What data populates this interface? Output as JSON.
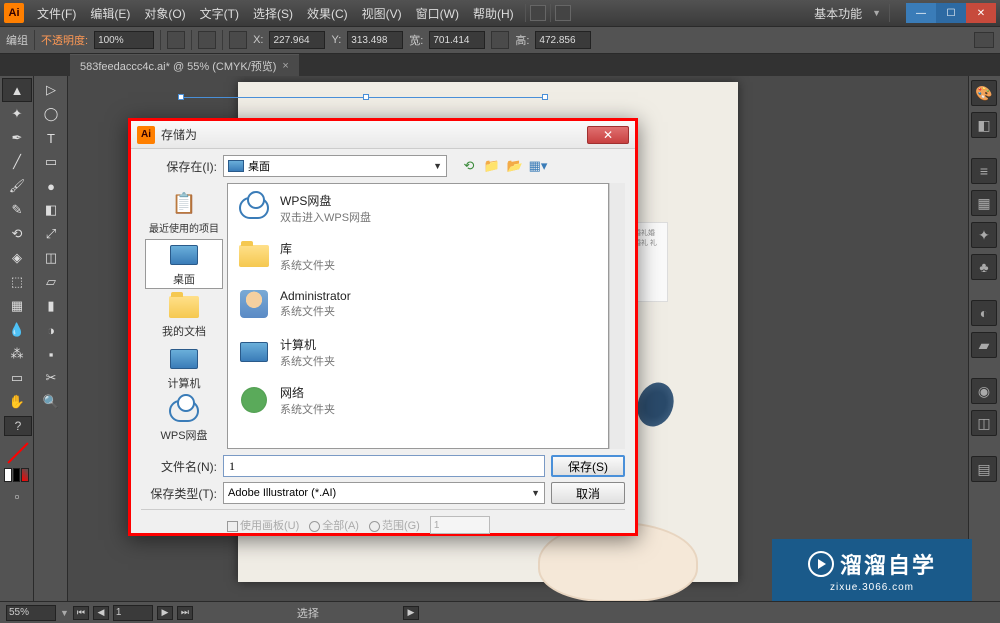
{
  "app": {
    "logo": "Ai"
  },
  "menu": {
    "file": "文件(F)",
    "edit": "编辑(E)",
    "object": "对象(O)",
    "type": "文字(T)",
    "select": "选择(S)",
    "effect": "效果(C)",
    "view": "视图(V)",
    "window": "窗口(W)",
    "help": "帮助(H)"
  },
  "workspace": {
    "label": "基本功能"
  },
  "options": {
    "group": "编组",
    "opacity_label": "不透明度:",
    "opacity_value": "100%",
    "x_label": "X:",
    "x_value": "227.964",
    "y_label": "Y:",
    "y_value": "313.498",
    "w_label": "宽:",
    "w_value": "701.414",
    "h_label": "高:",
    "h_value": "472.856"
  },
  "document": {
    "tab_title": "583feedaccc4c.ai* @ 55% (CMYK/预览)"
  },
  "status": {
    "zoom": "55%",
    "artboard": "1",
    "tool": "选择"
  },
  "watermark": {
    "main": "溜溜自学",
    "sub": "zixue.3066.com"
  },
  "dialog": {
    "title": "存储为",
    "save_in_label": "保存在(I):",
    "save_in_value": "桌面",
    "places": {
      "recent": "最近使用的项目",
      "desktop": "桌面",
      "documents": "我的文档",
      "computer": "计算机",
      "wps": "WPS网盘"
    },
    "files": {
      "wps": {
        "name": "WPS网盘",
        "desc": "双击进入WPS网盘"
      },
      "library": {
        "name": "库",
        "desc": "系统文件夹"
      },
      "admin": {
        "name": "Administrator",
        "desc": "系统文件夹"
      },
      "computer": {
        "name": "计算机",
        "desc": "系统文件夹"
      },
      "network": {
        "name": "网络",
        "desc": "系统文件夹"
      }
    },
    "filename_label": "文件名(N):",
    "filename_value": "1",
    "filetype_label": "保存类型(T):",
    "filetype_value": "Adobe Illustrator (*.AI)",
    "save_btn": "保存(S)",
    "cancel_btn": "取消",
    "use_artboard": "使用画板(U)",
    "all_radio": "全部(A)",
    "range_radio": "范围(G)",
    "range_value": "1"
  },
  "envelope_text": "婚礼婚礼婚礼婚\n婚礼婚礼婚礼婚\n婚礼婚礼婚礼婚\n婚礼婚礼婚礼\n礼婚礼"
}
